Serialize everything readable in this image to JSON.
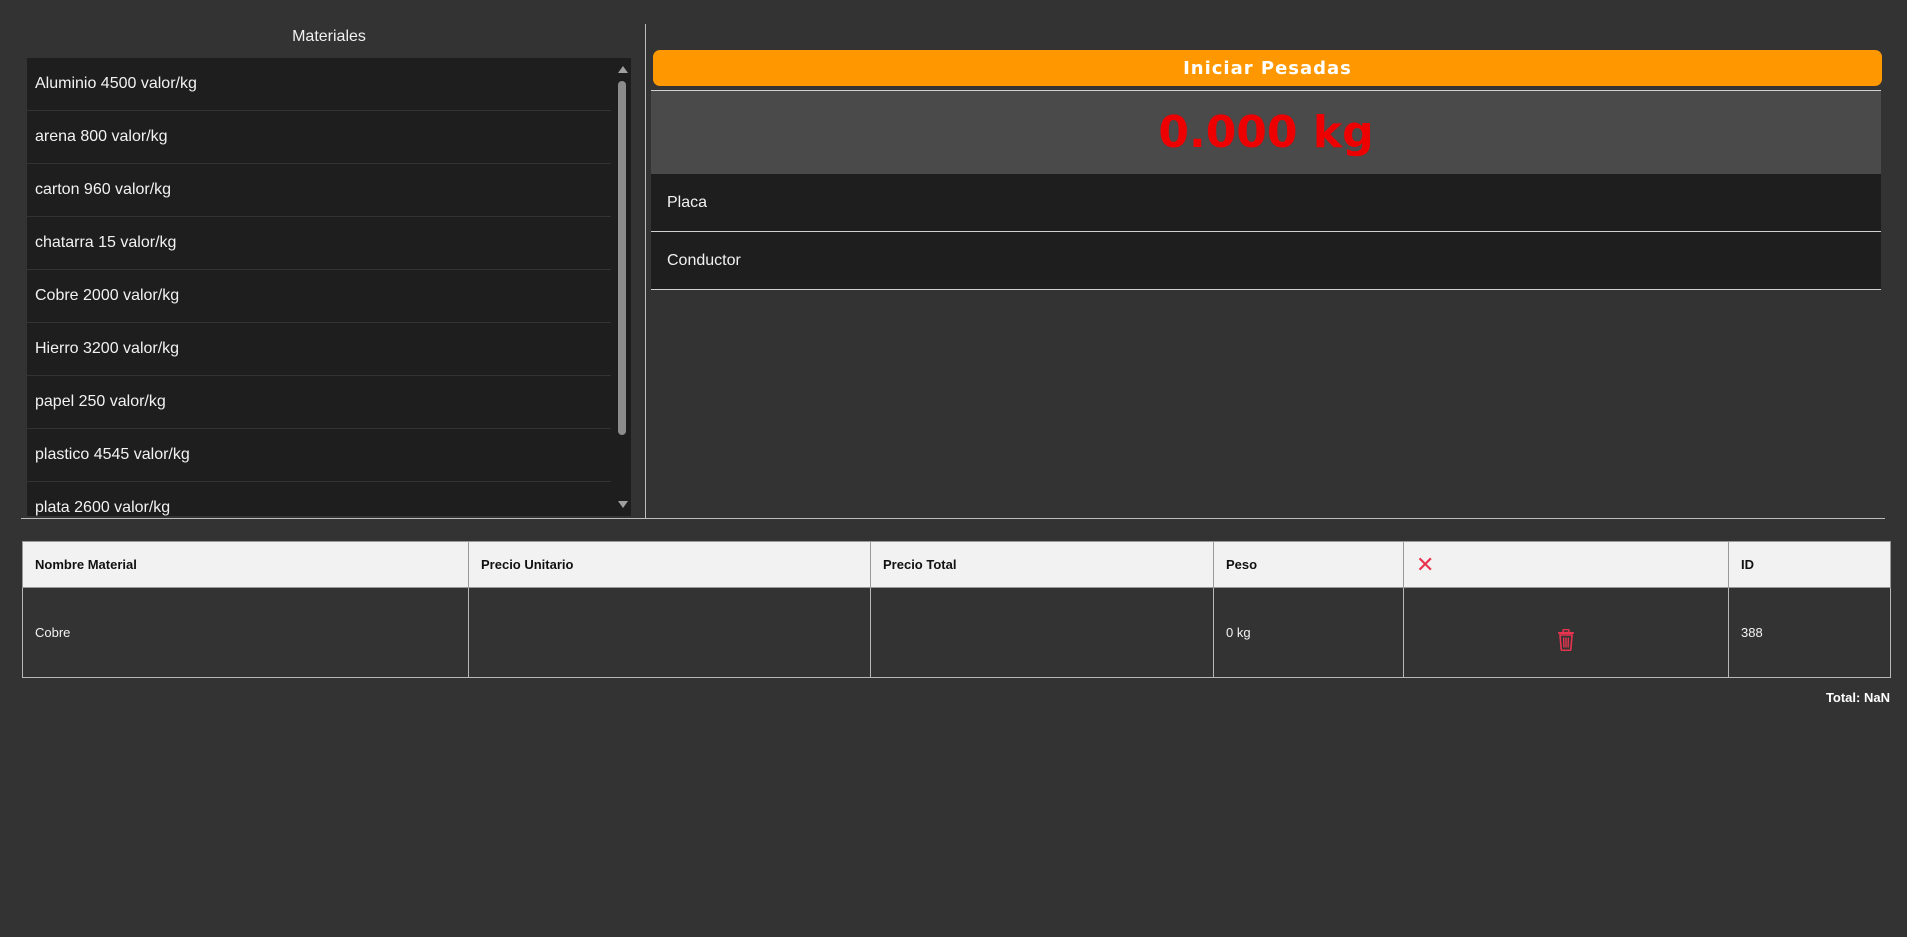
{
  "materials": {
    "title": "Materiales",
    "items": [
      {
        "label": "Aluminio 4500 valor/kg"
      },
      {
        "label": "arena 800 valor/kg"
      },
      {
        "label": "carton 960 valor/kg"
      },
      {
        "label": "chatarra 15 valor/kg"
      },
      {
        "label": "Cobre 2000 valor/kg"
      },
      {
        "label": "Hierro 3200 valor/kg"
      },
      {
        "label": "papel 250 valor/kg"
      },
      {
        "label": "plastico 4545 valor/kg"
      },
      {
        "label": "plata 2600 valor/kg"
      }
    ]
  },
  "weighing": {
    "start_label": "Iniciar Pesadas",
    "weight": "0.000 kg",
    "plate_placeholder": "Placa",
    "driver_placeholder": "Conductor"
  },
  "table": {
    "headers": {
      "name": "Nombre Material",
      "unit_price": "Precio Unitario",
      "total_price": "Precio Total",
      "weight": "Peso",
      "delete_icon": "close-icon",
      "id": "ID"
    },
    "rows": [
      {
        "name": "Cobre",
        "unit_price": "",
        "total_price": "",
        "weight": "0 kg",
        "action_icon": "trash-icon",
        "id": "388"
      }
    ]
  },
  "total": {
    "label": "Total:",
    "value": "NaN"
  },
  "colors": {
    "background": "#333333",
    "list_background": "#1e1e1e",
    "accent_orange": "#ff9800",
    "weight_red": "#ee0000",
    "delete_red": "#e8344e"
  }
}
